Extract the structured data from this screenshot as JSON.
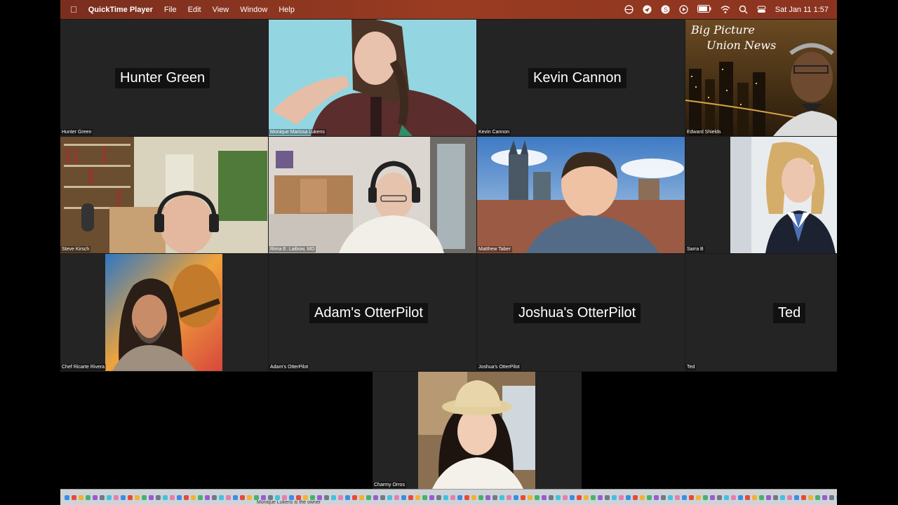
{
  "menubar": {
    "app_name": "QuickTime Player",
    "menus": [
      "File",
      "Edit",
      "View",
      "Window",
      "Help"
    ],
    "clock": "Sat Jan 11  1:57"
  },
  "tiles": {
    "hunter": {
      "caption": "Hunter Green",
      "name_display": "Hunter Green"
    },
    "monique": {
      "caption": "Monique Marissa Lukens"
    },
    "kevin": {
      "caption": "Kevin Cannon",
      "name_display": "Kevin Cannon"
    },
    "edward": {
      "caption": "Edward Shields",
      "overlay_line1": "Big Picture",
      "overlay_line2": "Union News"
    },
    "steve": {
      "caption": "Steve Kirsch"
    },
    "rima": {
      "caption": "Rima E. Laibow, MD"
    },
    "matthew": {
      "caption": "Matthew Taber"
    },
    "sarra": {
      "caption": "Sarra B"
    },
    "ricarte": {
      "caption": "Chef Ricarte Rivera"
    },
    "adam": {
      "caption": "Adam's OtterPilot",
      "name_display": "Adam's OtterPilot"
    },
    "joshua": {
      "caption": "Joshua's OtterPilot",
      "name_display": "Joshua's OtterPilot"
    },
    "ted": {
      "caption": "Ted",
      "name_display": "Ted"
    },
    "charmy": {
      "caption": "Charmy Orros"
    }
  },
  "dock": {
    "subtitle": "Monique Lukens is the owner"
  },
  "colors": {
    "menubar": "#9a3c22",
    "tile_bg": "#242424",
    "name_box": "#111111"
  }
}
